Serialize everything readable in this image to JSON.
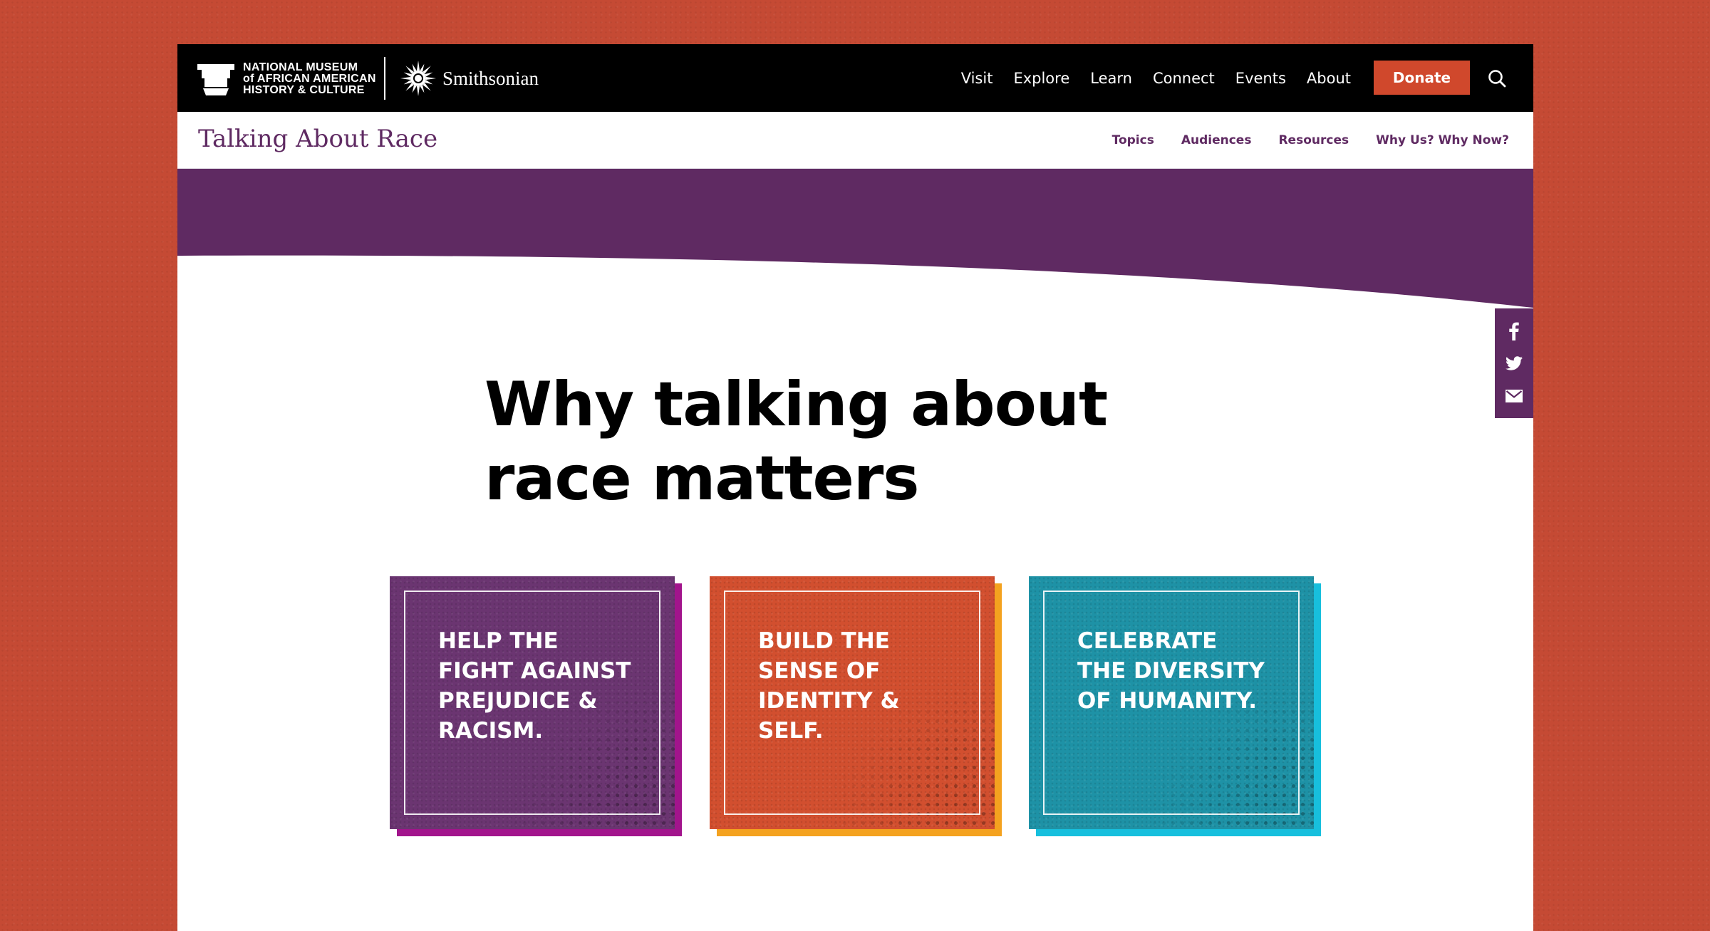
{
  "header": {
    "nmaahc_lines": [
      "NATIONAL MUSEUM",
      "of AFRICAN AMERICAN",
      "HISTORY & CULTURE"
    ],
    "smithsonian": "Smithsonian",
    "nav": [
      "Visit",
      "Explore",
      "Learn",
      "Connect",
      "Events",
      "About"
    ],
    "donate_label": "Donate"
  },
  "subheader": {
    "site_title": "Talking About Race",
    "nav": [
      "Topics",
      "Audiences",
      "Resources",
      "Why Us? Why Now?"
    ]
  },
  "main": {
    "heading": "Why talking about race matters",
    "cards": [
      {
        "text": "HELP THE\nFIGHT AGAINST\nPREJUDICE &\nRACISM.",
        "color": "#6b3571",
        "shadow": "#a2148c"
      },
      {
        "text": "BUILD THE\nSENSE OF\nIDENTITY &\nSELF.",
        "color": "#d24f2f",
        "shadow": "#f4a21f"
      },
      {
        "text": "CELEBRATE\nTHE DIVERSITY\nOF HUMANITY.",
        "color": "#1e92a6",
        "shadow": "#17bfdd"
      }
    ]
  },
  "share": [
    "facebook-icon",
    "twitter-icon",
    "email-icon"
  ],
  "colors": {
    "page_bg": "#c54a34",
    "brand_purple": "#5f2a62",
    "donate": "#d0482c"
  }
}
